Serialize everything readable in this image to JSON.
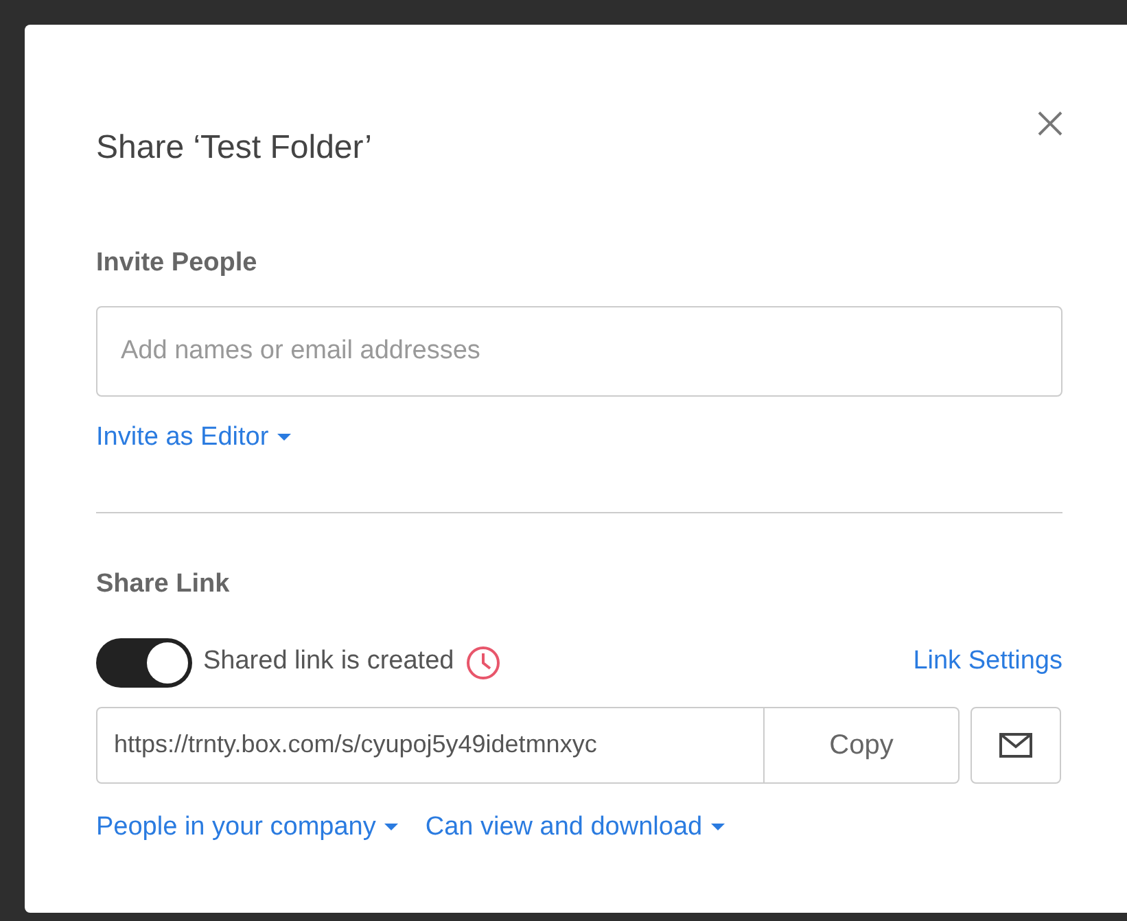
{
  "dialog": {
    "title": "Share ‘Test Folder’"
  },
  "invite": {
    "heading": "Invite People",
    "placeholder": "Add names or email addresses",
    "role_menu": "Invite as Editor"
  },
  "share_link": {
    "heading": "Share Link",
    "toggle": {
      "on": true,
      "label": "Shared link is created"
    },
    "settings_link": "Link Settings",
    "url": "https://trnty.box.com/s/cyupoj5y49idetmnxyc",
    "copy_button": "Copy",
    "access_menu": "People in your company",
    "permission_menu": "Can view and download"
  }
}
